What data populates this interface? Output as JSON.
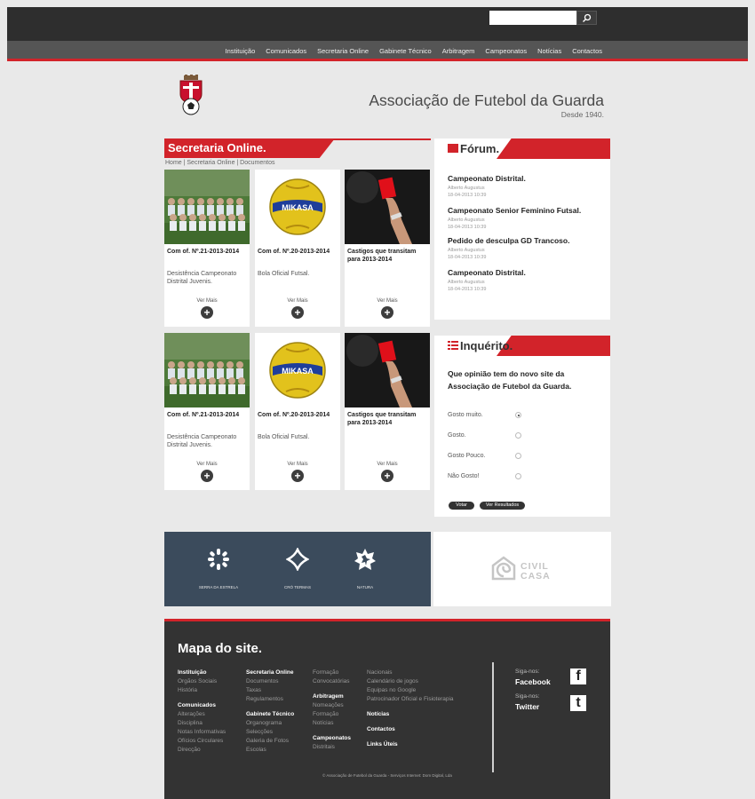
{
  "header": {
    "search": {
      "placeholder": ""
    },
    "nav": [
      "Instituição",
      "Comunicados",
      "Secretaria Online",
      "Gabinete Técnico",
      "Arbitragem",
      "Campeonatos",
      "Notícias",
      "Contactos"
    ]
  },
  "brand": {
    "title": "Associação de Futebol da Guarda",
    "since": "Desde 1940."
  },
  "secretaria": {
    "title": "Secretaria Online.",
    "breadcrumb": "Home | Secretaria Online | Documentos",
    "cards": [
      {
        "title": "Com of. Nº.21-2013-2014",
        "desc": "Desistência Campeonato Distrital Juvenis.",
        "more": "Ver Mais",
        "image": "team-photo"
      },
      {
        "title": "Com of. Nº.20-2013-2014",
        "desc": "Bola Oficial Futsal.",
        "more": "Ver Mais",
        "image": "ball-photo"
      },
      {
        "title": "Castigos que transitam para 2013-2014",
        "desc": "",
        "more": "Ver Mais",
        "image": "red-card-photo"
      },
      {
        "title": "Com of. Nº.21-2013-2014",
        "desc": "Desistência Campeonato Distrital Juvenis.",
        "more": "Ver Mais",
        "image": "team-photo"
      },
      {
        "title": "Com of. Nº.20-2013-2014",
        "desc": "Bola Oficial Futsal.",
        "more": "Ver Mais",
        "image": "ball-photo"
      },
      {
        "title": "Castigos que transitam para 2013-2014",
        "desc": "",
        "more": "Ver Mais",
        "image": "red-card-photo"
      }
    ]
  },
  "forum": {
    "title": "Fórum.",
    "items": [
      {
        "title": "Campeonato Distrital.",
        "author": "Alberto Augustus",
        "date": "18-04-2013 10:39"
      },
      {
        "title": "Campeonato Senior Feminino Futsal.",
        "author": "Alberto Augustus",
        "date": "18-04-2013 10:39"
      },
      {
        "title": "Pedido de desculpa GD Trancoso.",
        "author": "Alberto Augustus",
        "date": "18-04-2013 10:39"
      },
      {
        "title": "Campeonato Distrital.",
        "author": "Alberto Augustus",
        "date": "18-04-2013 10:39"
      }
    ]
  },
  "poll": {
    "title": "Inquérito.",
    "question": "Que opinião tem do novo site da Associação de Futebol da Guarda.",
    "options": [
      "Gosto muito.",
      "Gosto.",
      "Gosto Pouco.",
      "Não Gosto!"
    ],
    "selected_index": 0,
    "vote": "Votar",
    "results": "Ver Resultados"
  },
  "ads": {
    "labels": [
      "SERRA DA ESTRELA",
      "CRÓ TERMAS",
      "NATURA"
    ],
    "civil": [
      "CIVIL",
      "CASA"
    ]
  },
  "footer": {
    "title": "Mapa do site.",
    "col1": [
      {
        "t": "Instituição",
        "h": true
      },
      {
        "t": "Orgãos Sociais"
      },
      {
        "t": "História"
      },
      {
        "gap": true
      },
      {
        "t": "Comunicados",
        "h": true
      },
      {
        "t": "Alterações"
      },
      {
        "t": "Disciplina"
      },
      {
        "t": "Notas Informativas"
      },
      {
        "t": "Ofícios Circulares"
      },
      {
        "t": "Direcção"
      }
    ],
    "col2": [
      {
        "t": "Secretaria Online",
        "h": true
      },
      {
        "t": "Documentos"
      },
      {
        "t": "Taxas"
      },
      {
        "t": "Regulamentos"
      },
      {
        "gap": true
      },
      {
        "t": "Gabinete Técnico",
        "h": true
      },
      {
        "t": "Organograma"
      },
      {
        "t": "Selecções"
      },
      {
        "t": "Galeria de Fotos"
      },
      {
        "t": "Escolas"
      }
    ],
    "col3": [
      {
        "t": "Formação"
      },
      {
        "t": "Convocatórias"
      },
      {
        "gap": true
      },
      {
        "t": "Arbitragem",
        "h": true
      },
      {
        "t": "Nomeações"
      },
      {
        "t": "Formação"
      },
      {
        "t": "Notícias"
      },
      {
        "gap": true
      },
      {
        "t": "Campeonatos",
        "h": true
      },
      {
        "t": "Distritais"
      }
    ],
    "col4": [
      {
        "t": "Nacionais"
      },
      {
        "t": "Calendário de jogos"
      },
      {
        "t": "Equipas no Google"
      },
      {
        "t": "Patrocinador Oficial e Fisioterapia"
      },
      {
        "gap": true
      },
      {
        "t": "Notícias",
        "h": true
      },
      {
        "gap": true
      },
      {
        "t": "Contactos",
        "h": true
      },
      {
        "gap": true
      },
      {
        "t": "Links Úteis",
        "h": true
      }
    ],
    "social": [
      {
        "label": "Siga-nos:",
        "name": "Facebook",
        "icon": "f"
      },
      {
        "label": "Siga-nos:",
        "name": "Twitter",
        "icon": "t"
      }
    ],
    "copyright": "© Associação de Futebol da Guarda - Serviços Internet: Dom Digital, Lda"
  },
  "colors": {
    "accent": "#d2232a",
    "dark": "#333333",
    "nav": "#555555",
    "ads_bg": "#3b4b5c"
  }
}
